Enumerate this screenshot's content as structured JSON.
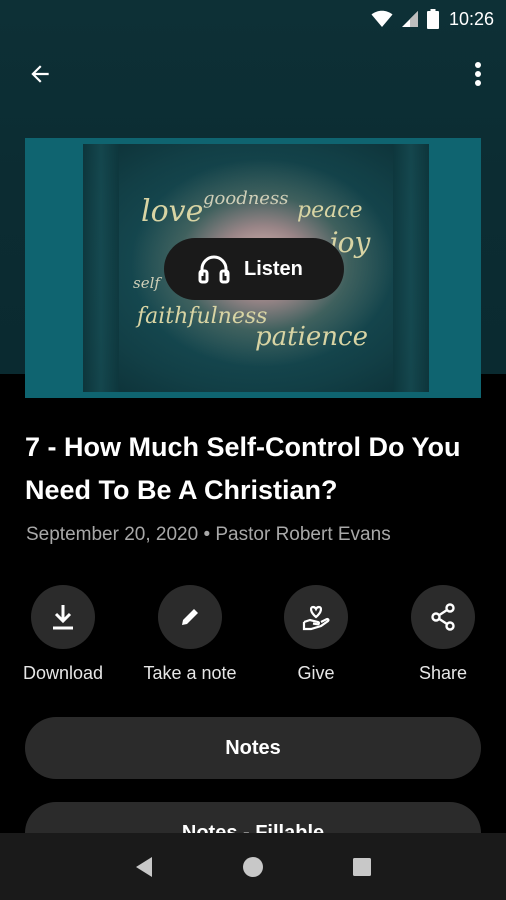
{
  "status_bar": {
    "time": "10:26",
    "icons": [
      "wifi-icon",
      "signal-icon",
      "battery-icon"
    ]
  },
  "app_bar": {
    "back_icon": "arrow-back-icon",
    "menu_icon": "more-vert-icon"
  },
  "artwork": {
    "words": [
      "love",
      "goodness",
      "peace",
      "joy",
      "self",
      "faithfulness",
      "patience"
    ],
    "listen_label": "Listen",
    "listen_icon": "headphones-icon"
  },
  "sermon": {
    "title": "7 - How Much Self-Control Do You Need To Be A Christian?",
    "meta": "September 20, 2020 • Pastor Robert Evans"
  },
  "actions": [
    {
      "label": "Download",
      "icon": "download-icon"
    },
    {
      "label": "Take a note",
      "icon": "pencil-icon"
    },
    {
      "label": "Give",
      "icon": "give-heart-hand-icon"
    },
    {
      "label": "Share",
      "icon": "share-icon"
    }
  ],
  "buttons": {
    "notes": "Notes",
    "notes_fillable": "Notes - Fillable"
  },
  "nav_bar": {
    "icons": [
      "nav-back-icon",
      "nav-home-icon",
      "nav-recents-icon"
    ]
  },
  "colors": {
    "header_bg": "#0c2c32",
    "artwork_frame": "#0f6470",
    "button_bg": "#2b2b2b",
    "pill_bg": "#1a1a1a",
    "meta_text": "#a8a8a8"
  }
}
